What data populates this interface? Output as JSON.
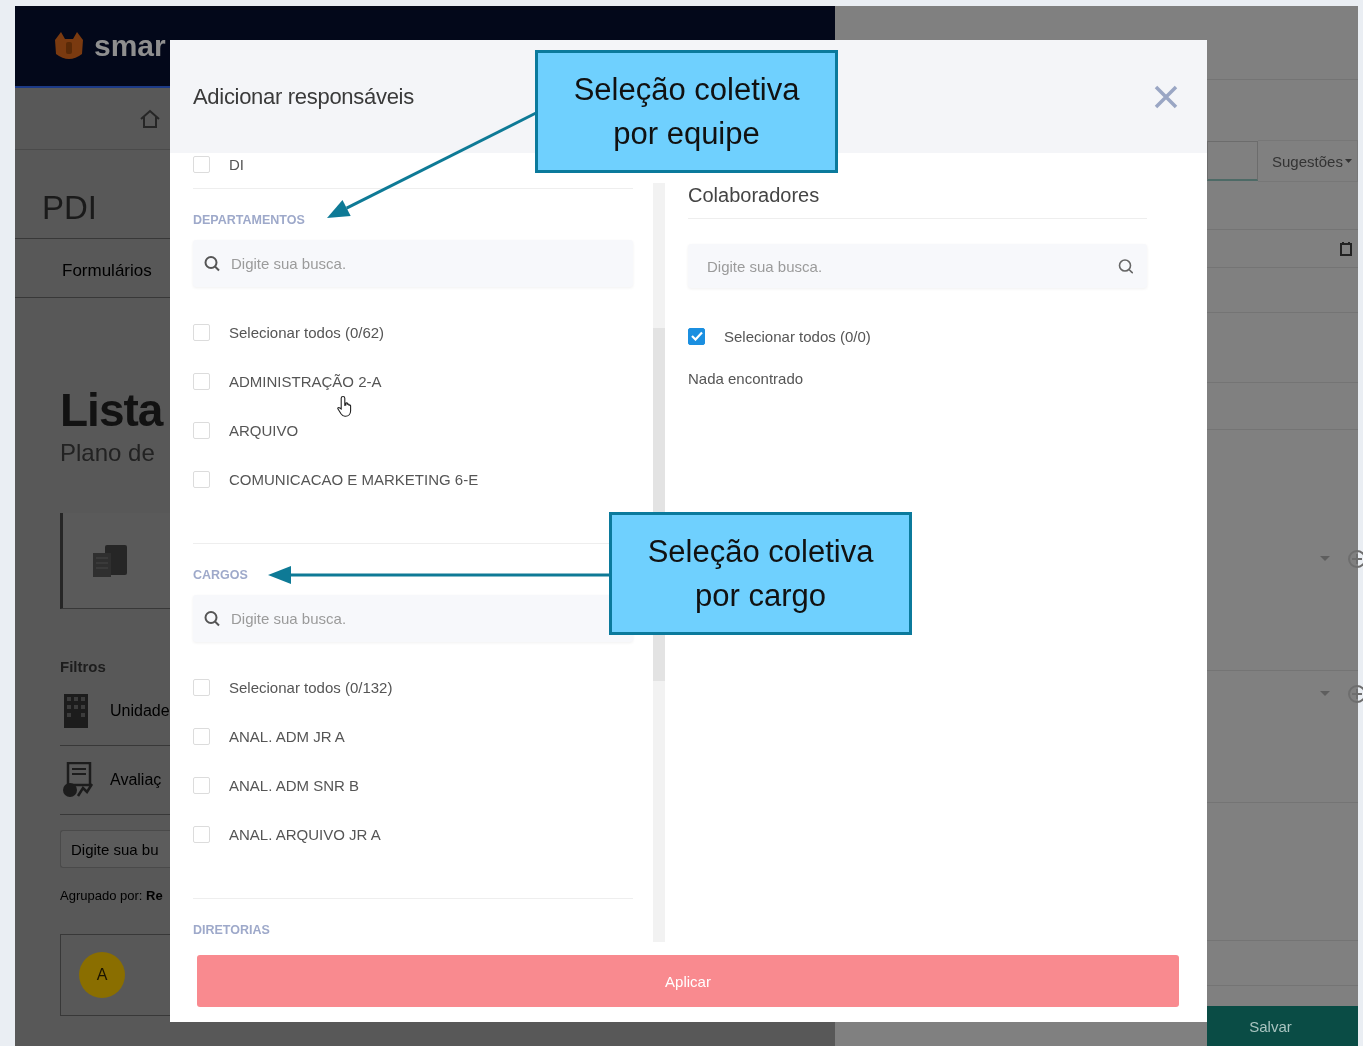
{
  "background": {
    "logo": "smar",
    "page_title": "PDI",
    "tab": "Formulários",
    "heading": "Lista",
    "subtitle": "Plano de",
    "filters_title": "Filtros",
    "filters": [
      {
        "kind": "building",
        "label": "Unidade"
      },
      {
        "kind": "chart",
        "label": "Avaliaç"
      }
    ],
    "search": {
      "placeholder": "Digite sua bu"
    },
    "grouped_by": "Agrupado por: **Re**",
    "avatar": "A",
    "suggestions": "Sugestões",
    "save": "Salvar"
  },
  "modal": {
    "title": "Adicionar responsáveis",
    "left": {
      "sections": [
        {
          "items": [
            {
              "label": "DI",
              "checked": false
            }
          ]
        },
        {
          "heading": "DEPARTAMENTOS",
          "search": {
            "placeholder": "Digite sua busca."
          },
          "items": [
            {
              "label": "Selecionar todos (0/62)",
              "checked": false
            },
            {
              "label": "ADMINISTRAÇÃO 2-A",
              "checked": false
            },
            {
              "label": "ARQUIVO",
              "checked": false
            },
            {
              "label": "COMUNICACAO E MARKETING 6-E",
              "checked": false
            }
          ]
        },
        {
          "heading": "CARGOS",
          "search": {
            "placeholder": "Digite sua busca."
          },
          "items": [
            {
              "label": "Selecionar todos (0/132)",
              "checked": false
            },
            {
              "label": "ANAL. ADM JR A",
              "checked": false
            },
            {
              "label": "ANAL. ADM SNR B",
              "checked": false
            },
            {
              "label": "ANAL. ARQUIVO JR A",
              "checked": false
            }
          ]
        },
        {
          "heading": "DIRETORIAS"
        }
      ]
    },
    "right": {
      "heading": "Colaboradores",
      "search": {
        "placeholder": "Digite sua busca."
      },
      "select_all": {
        "label": "Selecionar todos (0/0)",
        "checked": true
      },
      "empty": "Nada encontrado"
    },
    "apply": "Aplicar"
  },
  "annotations": [
    {
      "text": "Seleção coletiva por equipe"
    },
    {
      "text": "Seleção coletiva por cargo"
    }
  ]
}
